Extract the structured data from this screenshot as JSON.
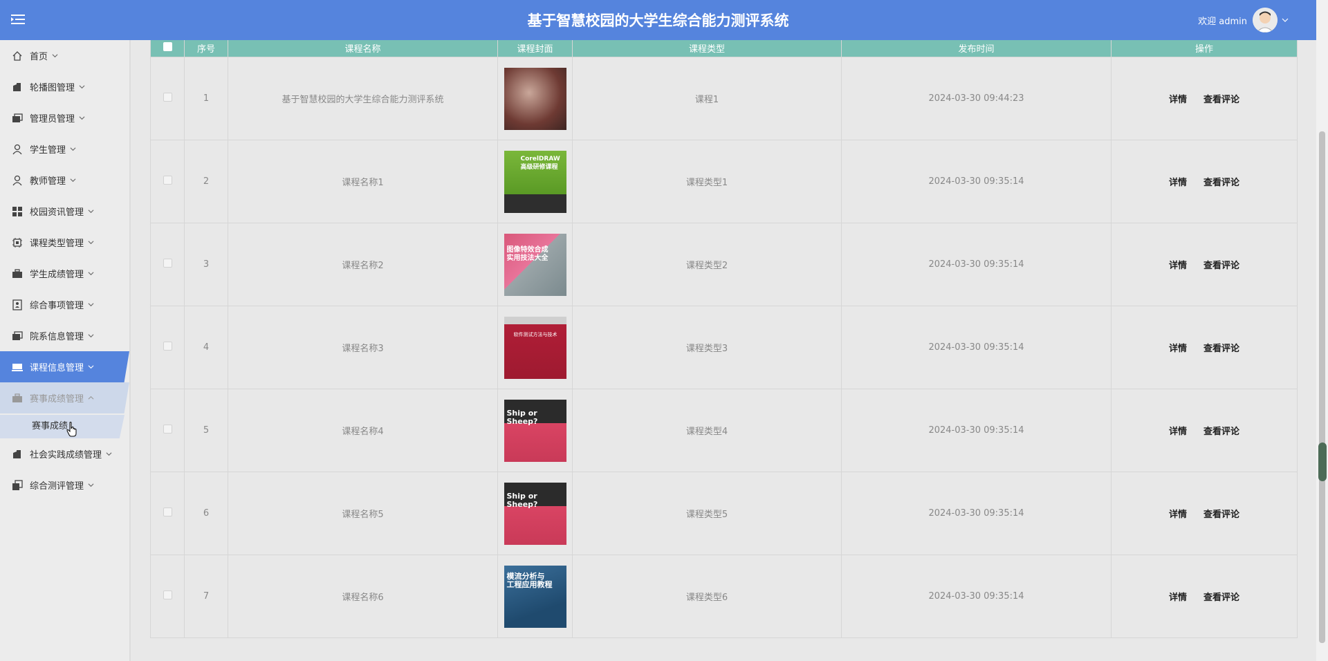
{
  "header": {
    "title": "基于智慧校园的大学生综合能力测评系统",
    "welcome": "欢迎 admin",
    "menu_icon": "hamburger-icon",
    "avatar_icon": "user-avatar-icon"
  },
  "sidebar": {
    "items": [
      {
        "label": "首页",
        "icon": "home-icon"
      },
      {
        "label": "轮播图管理",
        "icon": "building-icon"
      },
      {
        "label": "管理员管理",
        "icon": "folders-icon"
      },
      {
        "label": "学生管理",
        "icon": "user-icon"
      },
      {
        "label": "教师管理",
        "icon": "user-icon"
      },
      {
        "label": "校园资讯管理",
        "icon": "grid-icon"
      },
      {
        "label": "课程类型管理",
        "icon": "chip-icon"
      },
      {
        "label": "学生成绩管理",
        "icon": "briefcase-icon"
      },
      {
        "label": "综合事项管理",
        "icon": "contact-icon"
      },
      {
        "label": "院系信息管理",
        "icon": "folders-icon"
      },
      {
        "label": "课程信息管理",
        "icon": "laptop-icon"
      },
      {
        "label": "赛事成绩管理",
        "icon": "briefcase-icon"
      },
      {
        "label": "社会实践成绩管理",
        "icon": "building-icon"
      },
      {
        "label": "综合测评管理",
        "icon": "copy-icon"
      }
    ],
    "sub_item": "赛事成绩"
  },
  "table": {
    "columns": [
      "序号",
      "课程名称",
      "课程封面",
      "课程类型",
      "发布时间",
      "操作"
    ],
    "rows": [
      {
        "index": "1",
        "name": "基于智慧校园的大学生综合能力测评系统",
        "type": "课程1",
        "time": "2024-03-30 09:44:23"
      },
      {
        "index": "2",
        "name": "课程名称1",
        "type": "课程类型1",
        "time": "2024-03-30 09:35:14"
      },
      {
        "index": "3",
        "name": "课程名称2",
        "type": "课程类型2",
        "time": "2024-03-30 09:35:14"
      },
      {
        "index": "4",
        "name": "课程名称3",
        "type": "课程类型3",
        "time": "2024-03-30 09:35:14"
      },
      {
        "index": "5",
        "name": "课程名称4",
        "type": "课程类型4",
        "time": "2024-03-30 09:35:14"
      },
      {
        "index": "6",
        "name": "课程名称5",
        "type": "课程类型5",
        "time": "2024-03-30 09:35:14"
      },
      {
        "index": "7",
        "name": "课程名称6",
        "type": "课程类型6",
        "time": "2024-03-30 09:35:14"
      }
    ],
    "actions": {
      "detail": "详情",
      "comments": "查看评论"
    },
    "covers": [
      {
        "text": ""
      },
      {
        "text": "CorelDRAW\n高级研修课程"
      },
      {
        "text": "图像特效合成\n实用技法大全"
      },
      {
        "text": "软件测试方法与技术"
      },
      {
        "text": "Ship or Sheep?"
      },
      {
        "text": "Ship or Sheep?"
      },
      {
        "text": "模流分析与\n工程应用教程"
      }
    ]
  },
  "colors": {
    "header_bg": "#5584dd",
    "table_header_bg": "#78c0b4",
    "sidebar_bg": "#ececec",
    "active_item_bg": "#5584dd"
  }
}
